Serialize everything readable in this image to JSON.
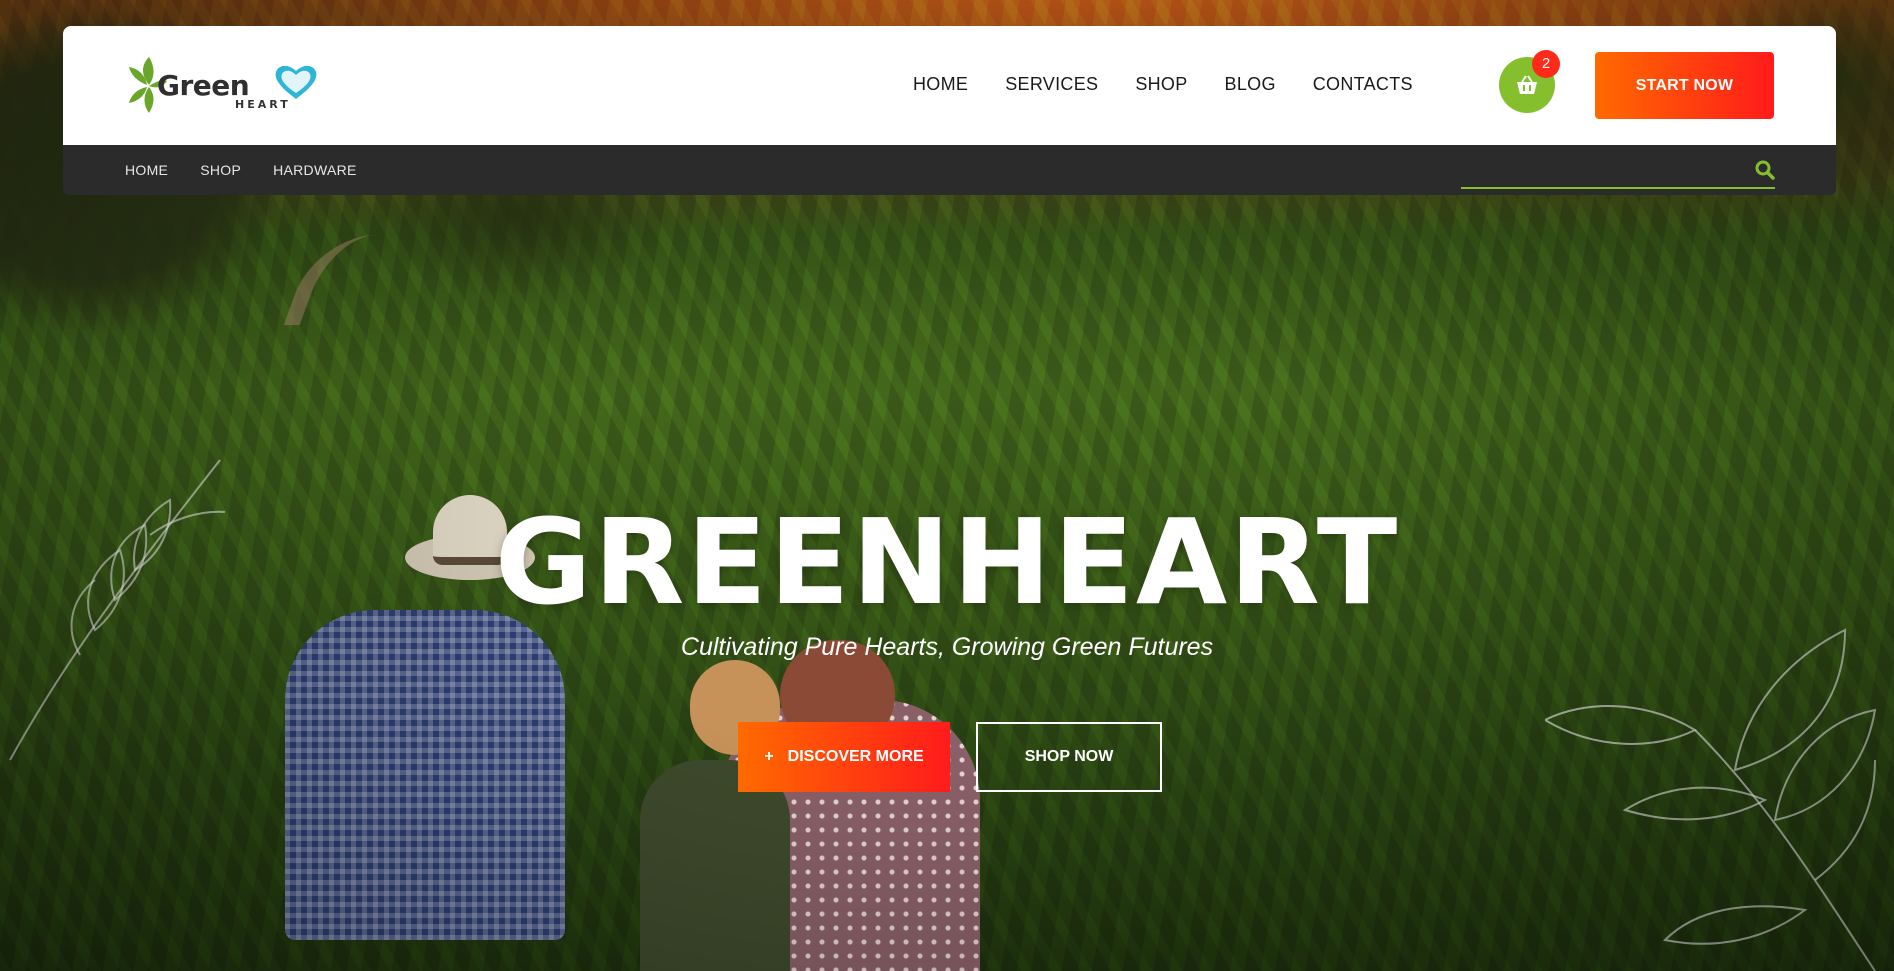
{
  "header": {
    "logo": {
      "text": "Green",
      "sub": "HEART"
    },
    "nav": [
      "HOME",
      "SERVICES",
      "SHOP",
      "BLOG",
      "CONTACTS"
    ],
    "cart": {
      "icon": "basket-icon",
      "count": "2"
    },
    "start_label": "START NOW"
  },
  "subbar": {
    "breadcrumbs": [
      "HOME",
      "SHOP",
      "HARDWARE"
    ],
    "search": {
      "placeholder": "",
      "icon": "search-icon"
    }
  },
  "hero": {
    "title": "GREENHEART",
    "subtitle": "Cultivating Pure Hearts, Growing Green Futures",
    "discover": {
      "plus": "+",
      "label": "DISCOVER MORE"
    },
    "shop_label": "SHOP NOW"
  },
  "colors": {
    "accent_green": "#86bf2d",
    "accent_orange": "#ff6a00",
    "accent_red": "#ff1b1b",
    "subbar_bg": "#2b2b2b"
  }
}
